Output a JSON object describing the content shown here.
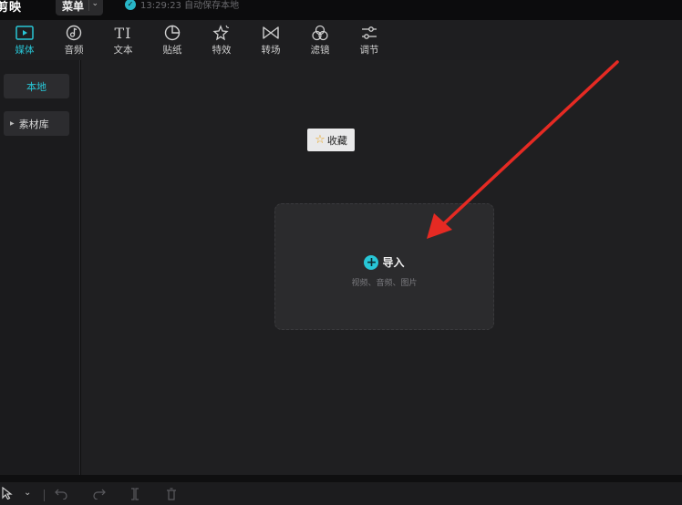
{
  "titlebar": {
    "app_name": "剪映",
    "menu_label": "菜单",
    "save_status": "13:29:23 自动保存本地"
  },
  "toolbar": {
    "items": [
      {
        "label": "媒体",
        "icon": "media-icon",
        "active": true
      },
      {
        "label": "音频",
        "icon": "audio-icon"
      },
      {
        "label": "文本",
        "icon": "text-icon",
        "glyph": "TI"
      },
      {
        "label": "贴纸",
        "icon": "sticker-icon"
      },
      {
        "label": "特效",
        "icon": "effects-icon"
      },
      {
        "label": "转场",
        "icon": "transition-icon"
      },
      {
        "label": "滤镜",
        "icon": "filter-icon"
      },
      {
        "label": "调节",
        "icon": "adjust-icon"
      }
    ]
  },
  "sidebar": {
    "local": "本地",
    "library": "素材库"
  },
  "main": {
    "favorite_label": "收藏",
    "import_label": "导入",
    "import_hint": "视频、音频、图片"
  },
  "colors": {
    "accent": "#28c6d6",
    "annotation_arrow": "#e52a23"
  }
}
